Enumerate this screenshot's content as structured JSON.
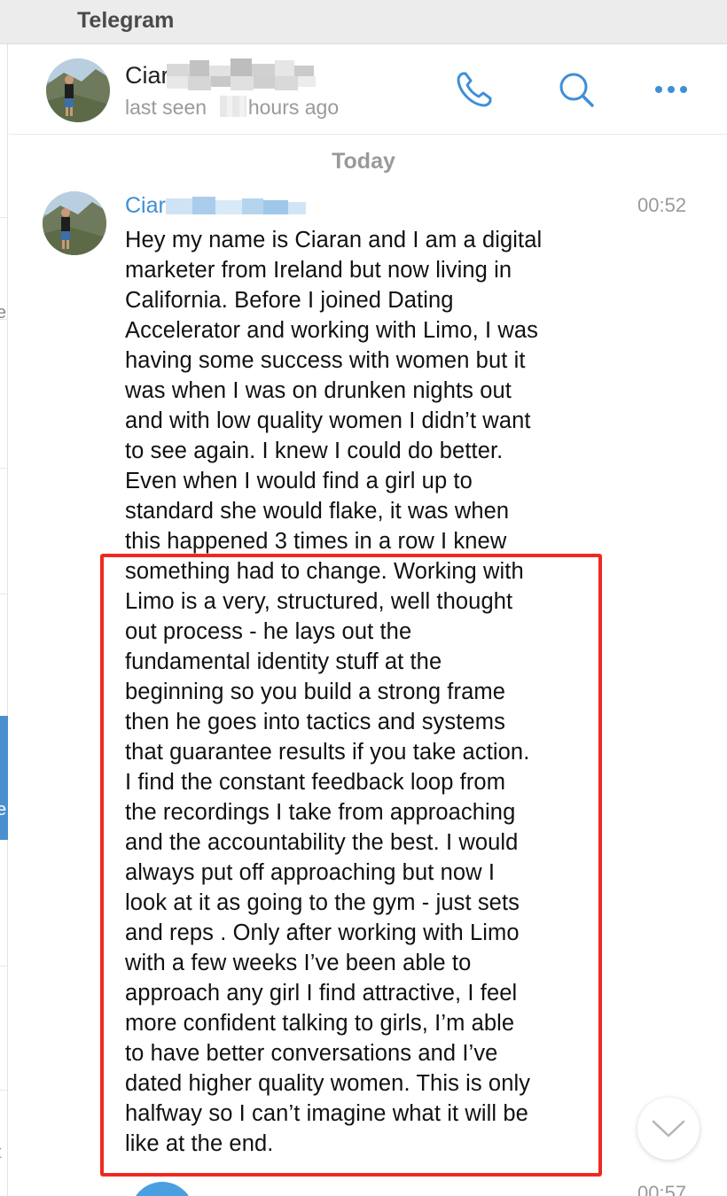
{
  "app": {
    "title": "Telegram"
  },
  "chat_header": {
    "name": "Ciar",
    "status_part1": "last seen",
    "status_part2": "hours ago",
    "actions": [
      "phone-icon",
      "search-icon",
      "more-icon"
    ]
  },
  "messages": {
    "date_separator": "Today",
    "first": {
      "sender": "Ciar",
      "time": "00:52",
      "lines": [
        "Hey my name is Ciaran and I am a digital",
        "marketer from Ireland but now living in",
        "California. Before I joined Dating",
        "Accelerator and working with Limo, I was",
        "having some success with women but it",
        "was when I was on drunken nights out",
        "and with low quality women I didn’t want",
        "to see again. I knew I could do better.",
        "Even when I would find a girl up to",
        "standard she would flake, it was when",
        "this happened 3 times in a row I knew",
        "something had to change. Working with",
        "Limo is a very, structured, well thought",
        "out process - he lays out the",
        "fundamental identity stuff at the",
        "beginning so you build a strong frame",
        "then he goes into tactics and systems",
        "that guarantee results if you take action.",
        "I find the constant feedback loop from",
        "the recordings I take from approaching",
        "and the accountability the best. I would",
        "always put off approaching but now I",
        "look at it as going to the gym - just sets",
        "and reps . Only after working with Limo",
        "with a few weeks I’ve been able to",
        "approach any girl I find attractive, I feel",
        "more confident talking to girls, I’m able",
        "to have better conversations and I’ve",
        "dated higher quality women. This is only",
        "halfway so I can’t imagine what it will be",
        "like at the end."
      ]
    },
    "next": {
      "time": "00:57"
    }
  },
  "sidebar_fragments": [
    "e",
    "e",
    "t"
  ],
  "colors": {
    "accent": "#3e8fd6",
    "highlight_border": "#ee2a1f",
    "sidebar_active": "#4a90cf"
  }
}
